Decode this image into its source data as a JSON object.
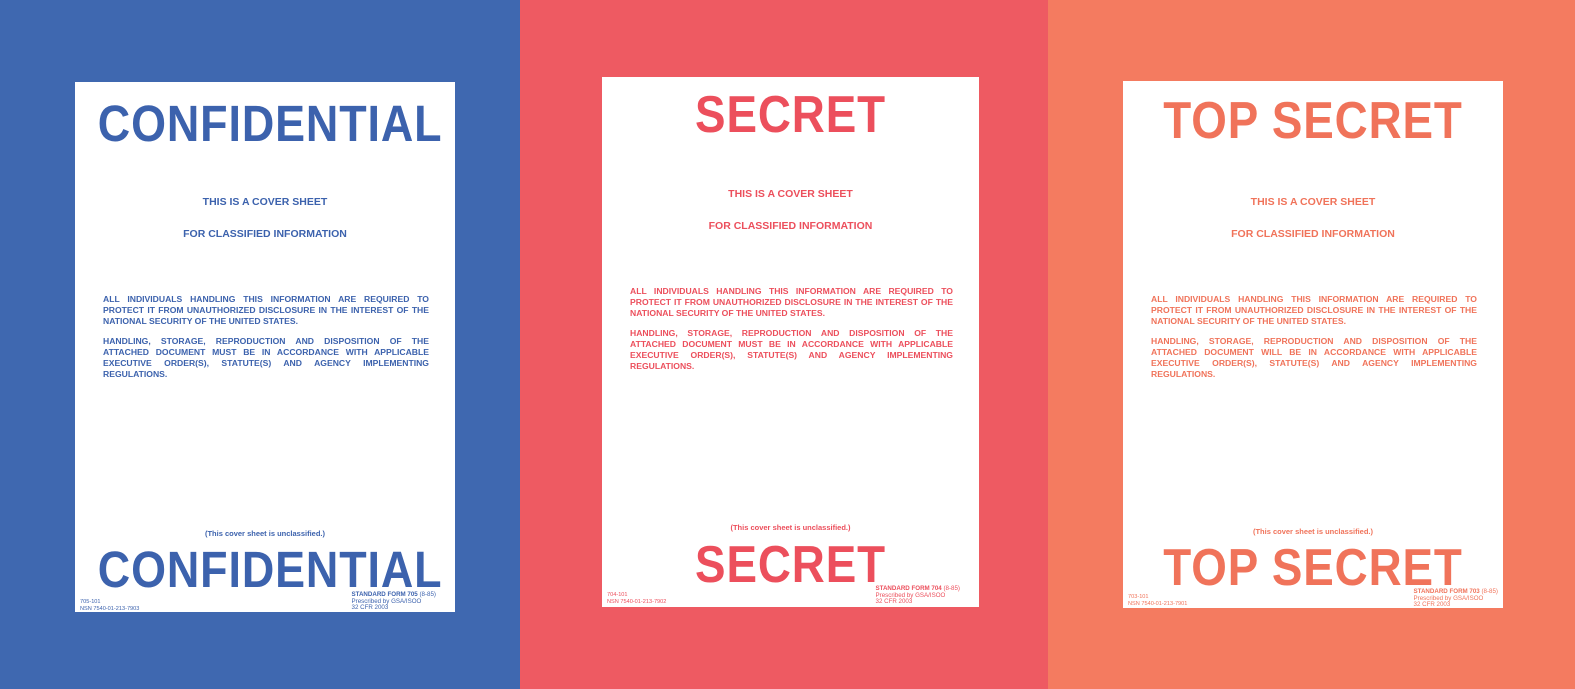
{
  "sheets": [
    {
      "heading": "CONFIDENTIAL",
      "subtitle1": "THIS IS A COVER SHEET",
      "subtitle2": "FOR CLASSIFIED INFORMATION",
      "paragraph1": "ALL INDIVIDUALS HANDLING THIS INFORMATION ARE REQUIRED TO PROTECT IT FROM UNAUTHORIZED DISCLOSURE IN THE INTEREST OF THE NATIONAL SECURITY OF THE UNITED STATES.",
      "paragraph2": "HANDLING, STORAGE, REPRODUCTION AND DISPOSITION OF THE ATTACHED DOCUMENT MUST BE IN ACCORDANCE WITH APPLICABLE EXECUTIVE ORDER(S), STATUTE(S) AND AGENCY IMPLEMENTING REGULATIONS.",
      "note": "(This cover sheet is unclassified.)",
      "code1": "705-101",
      "code2": "NSN 7540-01-213-7903",
      "form1": "STANDARD FORM 705",
      "form1_suffix": "(8-85)",
      "form2": "Prescribed by GSA/ISOO",
      "form3": "32 CFR 2003",
      "colors": {
        "background": "#3f68b0",
        "ink": "#3c62ad"
      }
    },
    {
      "heading": "SECRET",
      "subtitle1": "THIS IS A COVER SHEET",
      "subtitle2": "FOR CLASSIFIED INFORMATION",
      "paragraph1": "ALL INDIVIDUALS HANDLING THIS INFORMATION ARE REQUIRED TO PROTECT IT FROM UNAUTHORIZED DISCLOSURE IN THE INTEREST OF THE NATIONAL SECURITY OF THE UNITED STATES.",
      "paragraph2": "HANDLING, STORAGE, REPRODUCTION AND DISPOSITION OF THE ATTACHED DOCUMENT MUST BE IN ACCORDANCE WITH APPLICABLE EXECUTIVE ORDER(S), STATUTE(S) AND AGENCY IMPLEMENTING REGULATIONS.",
      "note": "(This cover sheet is unclassified.)",
      "code1": "704-101",
      "code2": "NSN 7540-01-213-7902",
      "form1": "STANDARD FORM 704",
      "form1_suffix": "(8-85)",
      "form2": "Prescribed by GSA/ISOO",
      "form3": "32 CFR 2003",
      "colors": {
        "background": "#ee5a62",
        "ink": "#ec4f5c"
      }
    },
    {
      "heading": "TOP SECRET",
      "subtitle1": "THIS IS A COVER SHEET",
      "subtitle2": "FOR CLASSIFIED INFORMATION",
      "paragraph1": "ALL INDIVIDUALS HANDLING THIS INFORMATION ARE REQUIRED TO PROTECT IT FROM UNAUTHORIZED DISCLOSURE IN THE INTEREST OF THE NATIONAL SECURITY OF THE UNITED STATES.",
      "paragraph2": "HANDLING, STORAGE, REPRODUCTION AND DISPOSITION OF THE ATTACHED DOCUMENT WILL BE IN ACCORDANCE WITH APPLICABLE EXECUTIVE ORDER(S), STATUTE(S) AND AGENCY IMPLEMENTING REGULATIONS.",
      "note": "(This cover sheet is unclassified.)",
      "code1": "703-101",
      "code2": "NSN 7540-01-213-7901",
      "form1": "STANDARD FORM 703",
      "form1_suffix": "(8-85)",
      "form2": "Prescribed by GSA/ISOO",
      "form3": "32 CFR 2003",
      "colors": {
        "background": "#f47b60",
        "ink": "#f0735a"
      }
    }
  ]
}
